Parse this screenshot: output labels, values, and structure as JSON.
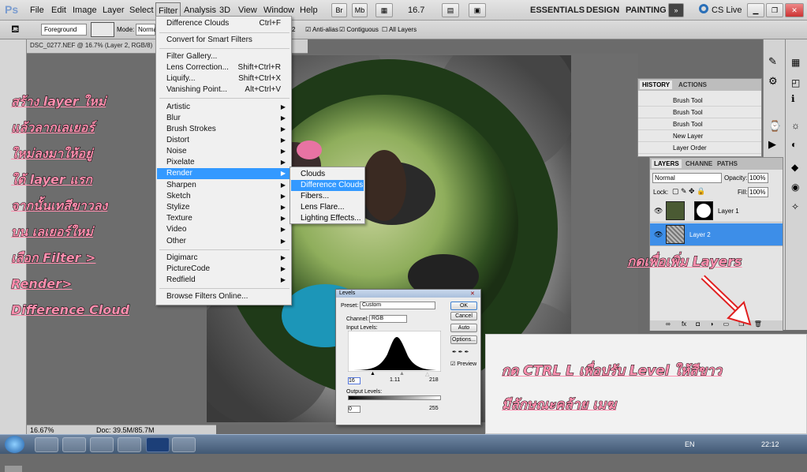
{
  "menubar": {
    "logo": "Ps",
    "items": [
      "File",
      "Edit",
      "Image",
      "Layer",
      "Select",
      "Filter",
      "Analysis",
      "3D",
      "View",
      "Window",
      "Help"
    ],
    "zoom": "16.7",
    "workspaces": [
      "ESSENTIALS",
      "DESIGN",
      "PAINTING"
    ],
    "cslive": "CS Live"
  },
  "options": {
    "brush_target": "Foreground",
    "mode_label": "Mode:",
    "mode_value": "Norma",
    "anti_alias": "Anti-alias",
    "contiguous": "Contiguous",
    "all_layers": "All Layers",
    "tolerance_tail": "2"
  },
  "document": {
    "tab": "DSC_0277.NEF @ 16.7% (Layer 2, RGB/8)",
    "zoom": "16.67%",
    "doc": "Doc: 39.5M/85.7M"
  },
  "filter_menu": {
    "top": [
      {
        "label": "Difference Clouds",
        "shortcut": "Ctrl+F"
      }
    ],
    "smart": "Convert for Smart Filters",
    "gallery": [
      {
        "label": "Filter Gallery...",
        "shortcut": ""
      },
      {
        "label": "Lens Correction...",
        "shortcut": "Shift+Ctrl+R"
      },
      {
        "label": "Liquify...",
        "shortcut": "Shift+Ctrl+X"
      },
      {
        "label": "Vanishing Point...",
        "shortcut": "Alt+Ctrl+V"
      }
    ],
    "subs": [
      "Artistic",
      "Blur",
      "Brush Strokes",
      "Distort",
      "Noise",
      "Pixelate",
      "Render",
      "Sharpen",
      "Sketch",
      "Stylize",
      "Texture",
      "Video",
      "Other"
    ],
    "third": [
      "Digimarc",
      "PictureCode",
      "Redfield"
    ],
    "browse": "Browse Filters Online..."
  },
  "render_submenu": [
    "Clouds",
    "Difference Clouds",
    "Fibers...",
    "Lens Flare...",
    "Lighting Effects..."
  ],
  "history": {
    "tabs": [
      "HISTORY",
      "ACTIONS"
    ],
    "items": [
      "Brush Tool",
      "Brush Tool",
      "Brush Tool",
      "New Layer",
      "Layer Order"
    ]
  },
  "layers": {
    "tabs": [
      "LAYERS",
      "CHANNE",
      "PATHS"
    ],
    "blend": "Normal",
    "opacity_label": "Opacity:",
    "opacity": "100%",
    "lock_label": "Lock:",
    "fill_label": "Fill:",
    "fill": "100%",
    "items": [
      {
        "name": "Layer 1"
      },
      {
        "name": "Layer 2"
      }
    ]
  },
  "levels": {
    "title": "Levels",
    "preset_label": "Preset:",
    "preset": "Custom",
    "channel_label": "Channel:",
    "channel": "RGB",
    "input_label": "Input Levels:",
    "input": [
      "16",
      "1.11",
      "218"
    ],
    "output_label": "Output Levels:",
    "output": [
      "0",
      "255"
    ],
    "buttons": [
      "OK",
      "Cancel",
      "Auto",
      "Options..."
    ],
    "preview": "Preview"
  },
  "annotations": {
    "left": [
      "สร้าง layer ใหม่",
      "แล้วลากเลเยอร์",
      "ใหม่ลงมาให้อยู่",
      "ใต้ layer แรก",
      "จากนั้นเทสีขาวลง",
      "บน เลเยอร์ใหม่",
      "เลือก Filter >",
      "Render>",
      "Difference Cloud"
    ],
    "add_layers": "กดเพื่อเพิ่ม Layers",
    "levels_note": [
      "กด CTRL L เพื่อปรับ Level ให้สีขาว",
      "มีลักษณะคล้าย เมฆ"
    ]
  },
  "taskbar": {
    "lang": "EN",
    "time": "22:12"
  }
}
